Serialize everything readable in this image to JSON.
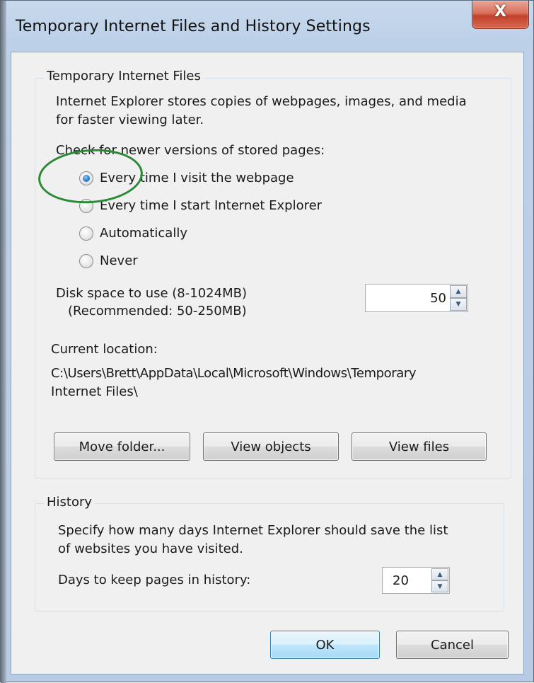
{
  "window": {
    "title": "Temporary Internet Files and History Settings",
    "close_glyph": "X"
  },
  "tif": {
    "group_label": "Temporary Internet Files",
    "description_line1": "Internet Explorer stores copies of webpages, images, and media",
    "description_line2": "for faster viewing later.",
    "check_label": "Check for newer versions of stored pages:",
    "options": [
      {
        "label": "Every time I visit the webpage",
        "checked": true
      },
      {
        "label": "Every time I start Internet Explorer",
        "checked": false
      },
      {
        "label": "Automatically",
        "checked": false
      },
      {
        "label": "Never",
        "checked": false
      }
    ],
    "disk_space_label": "Disk space to use (8-1024MB)",
    "disk_space_recommended": "(Recommended: 50-250MB)",
    "disk_space_value": "50",
    "current_location_label": "Current location:",
    "current_location_line1": "C:\\Users\\Brett\\AppData\\Local\\Microsoft\\Windows\\Temporary",
    "current_location_line2": "Internet Files\\",
    "buttons": {
      "move_folder": "Move folder...",
      "view_objects": "View objects",
      "view_files": "View files"
    }
  },
  "history": {
    "group_label": "History",
    "description_line1": "Specify how many days Internet Explorer should save the list",
    "description_line2": "of websites you have visited.",
    "days_label": "Days to keep pages in history:",
    "days_value": "20"
  },
  "footer": {
    "ok_label": "OK",
    "cancel_label": "Cancel"
  },
  "colors": {
    "annotation": "#2a8a34",
    "close_button": "#c4402a",
    "default_button_border": "#3c7fb1"
  },
  "icons": {
    "spin_up": "up-arrow-icon",
    "spin_down": "down-arrow-icon",
    "close": "close-icon"
  }
}
